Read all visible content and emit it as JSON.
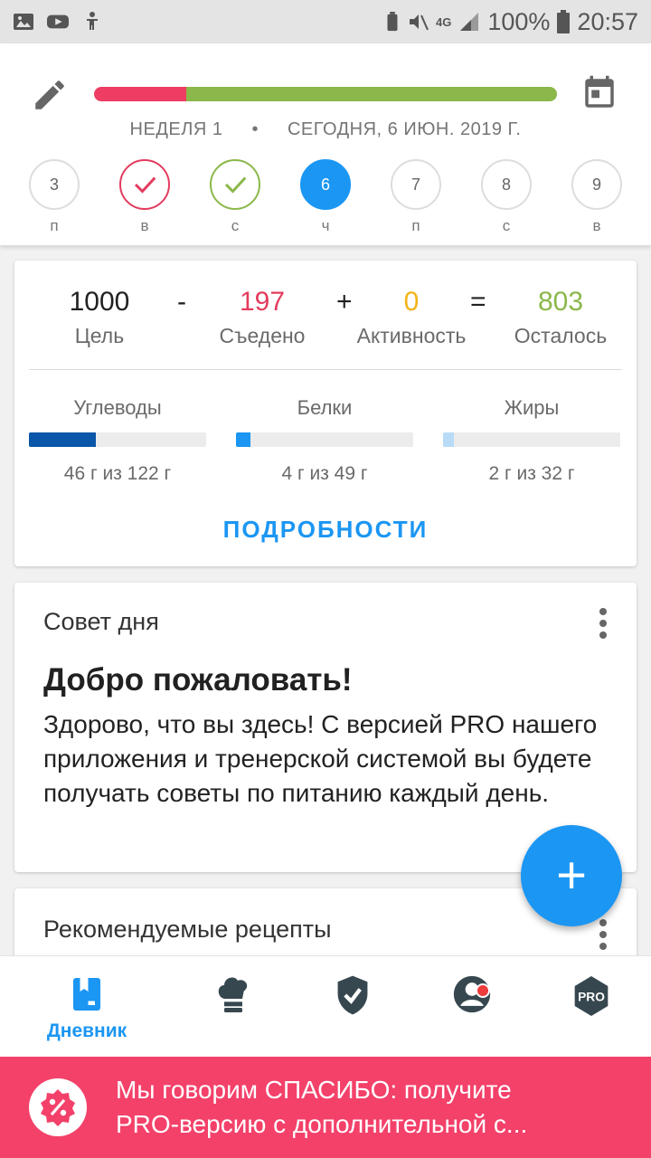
{
  "status_bar": {
    "battery": "100%",
    "time": "20:57",
    "network": "4G"
  },
  "header": {
    "progress": {
      "eaten_fraction": 0.2
    },
    "week_label": "НЕДЕЛЯ 1",
    "separator": "•",
    "date_label": "СЕГОДНЯ, 6 ИЮН. 2019 Г.",
    "days": [
      {
        "num": "3",
        "label": "п",
        "state": "none"
      },
      {
        "num": "",
        "label": "в",
        "state": "red-check"
      },
      {
        "num": "",
        "label": "с",
        "state": "green-check"
      },
      {
        "num": "6",
        "label": "ч",
        "state": "today"
      },
      {
        "num": "7",
        "label": "п",
        "state": "none"
      },
      {
        "num": "8",
        "label": "с",
        "state": "none"
      },
      {
        "num": "9",
        "label": "в",
        "state": "none"
      }
    ]
  },
  "summary": {
    "goal": {
      "value": "1000",
      "label": "Цель"
    },
    "op_minus": "-",
    "eaten": {
      "value": "197",
      "label": "Съедено",
      "color": "#e33c5e"
    },
    "op_plus": "+",
    "activity": {
      "value": "0",
      "label": "Активность",
      "color": "#f2b316"
    },
    "op_equals": "=",
    "remaining": {
      "value": "803",
      "label": "Осталось",
      "color": "#8bb84a"
    },
    "macros": [
      {
        "name": "Углеводы",
        "text": "46 г из 122 г",
        "fraction": 0.377,
        "color": "#0a56a8"
      },
      {
        "name": "Белки",
        "text": "4 г из 49 г",
        "fraction": 0.082,
        "color": "#1b96f3"
      },
      {
        "name": "Жиры",
        "text": "2 г из 32 г",
        "fraction": 0.0625,
        "color": "#b8dcf8"
      }
    ],
    "details_button": "ПОДРОБНОСТИ"
  },
  "tip": {
    "title": "Совет дня",
    "headline": "Добро пожаловать!",
    "body": "Здорово, что вы здесь! С версией PRO нашего приложения и тренерской системой вы будете получать советы по питанию каждый день."
  },
  "recipes": {
    "title": "Рекомендуемые рецепты"
  },
  "fab": {
    "label": "+"
  },
  "bottom_nav": {
    "items": [
      {
        "label": "Дневник",
        "icon": "diary-icon",
        "active": true
      },
      {
        "label": "",
        "icon": "chef-hat-icon"
      },
      {
        "label": "",
        "icon": "shield-check-icon"
      },
      {
        "label": "",
        "icon": "profile-icon"
      },
      {
        "label": "",
        "icon": "pro-badge-icon"
      }
    ],
    "pro_text": "PRO"
  },
  "promo": {
    "line1": "Мы говорим СПАСИБО: получите",
    "line2": "PRO-версию с дополнительной с..."
  },
  "colors": {
    "accent": "#1b96f3",
    "promo_bg": "#f3416a"
  }
}
